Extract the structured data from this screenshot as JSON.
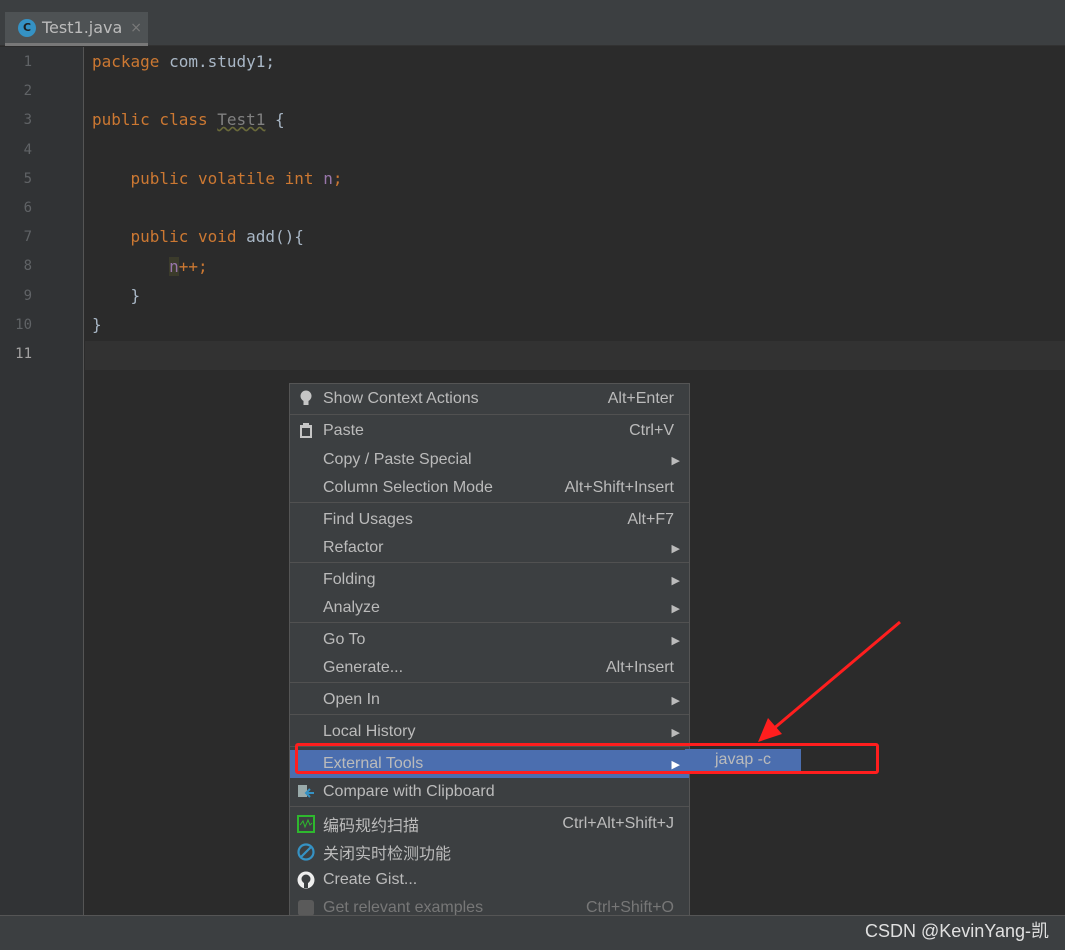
{
  "tab": {
    "icon": "java-class-icon",
    "letter": "C",
    "title": "Test1.java",
    "close": "×"
  },
  "lines": [
    "1",
    "2",
    "3",
    "4",
    "5",
    "6",
    "7",
    "8",
    "9",
    "10",
    "11"
  ],
  "code": {
    "l1": {
      "kw": "package",
      "rest": " com.study1;"
    },
    "l3": {
      "kw": "public class",
      "cls": "Test1",
      "rest": " {"
    },
    "l5": {
      "kw": "public volatile int",
      "fld": "n",
      "rest": ";"
    },
    "l7": {
      "kw": "public void",
      "fn": " add(){"
    },
    "l8": {
      "fld": "n",
      "rest": "++;"
    },
    "l9": "}",
    "l10": "}"
  },
  "menu": {
    "items": [
      {
        "label": "Show Context Actions",
        "shortcut": "Alt+Enter",
        "icon": "lightbulb-icon"
      },
      {
        "label": "Paste",
        "shortcut": "Ctrl+V",
        "icon": "clipboard-icon"
      },
      {
        "label": "Copy / Paste Special",
        "submenu": true
      },
      {
        "label": "Column Selection Mode",
        "shortcut": "Alt+Shift+Insert"
      },
      {
        "label": "Find Usages",
        "shortcut": "Alt+F7"
      },
      {
        "label": "Refactor",
        "submenu": true
      },
      {
        "label": "Folding",
        "submenu": true
      },
      {
        "label": "Analyze",
        "submenu": true
      },
      {
        "label": "Go To",
        "submenu": true
      },
      {
        "label": "Generate...",
        "shortcut": "Alt+Insert"
      },
      {
        "label": "Open In",
        "submenu": true
      },
      {
        "label": "Local History",
        "submenu": true
      },
      {
        "label": "External Tools",
        "submenu": true,
        "selected": true
      },
      {
        "label": "Compare with Clipboard",
        "icon": "compare-icon"
      },
      {
        "label": "编码规约扫描",
        "shortcut": "Ctrl+Alt+Shift+J",
        "icon": "scan-icon"
      },
      {
        "label": "关闭实时检测功能",
        "icon": "disable-icon"
      },
      {
        "label": "Create Gist...",
        "icon": "github-icon"
      },
      {
        "label": "Get relevant examples",
        "shortcut": "Ctrl+Shift+O",
        "disabled": true
      }
    ]
  },
  "submenu": {
    "item": "javap -c"
  },
  "annotation": {
    "color": "#ff1e1e"
  },
  "watermark": "CSDN @KevinYang-凯",
  "colors": {
    "selection": "#4b6eaf",
    "keyword": "#cc7832",
    "field": "#9876aa"
  }
}
